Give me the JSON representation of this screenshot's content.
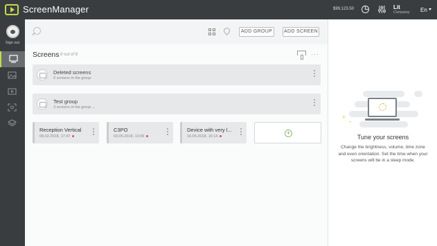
{
  "header": {
    "app_title": "ScreenManager",
    "balance": "$99,123.50",
    "user_name": "Lit",
    "user_role": "Company",
    "language": "En"
  },
  "sidebar": {
    "signout_label": "Sign out",
    "items": [
      "screens-icon",
      "images-icon",
      "video-icon",
      "scan-icon",
      "layers-icon"
    ]
  },
  "toolbar": {
    "add_group_label": "ADD GROUP",
    "add_screen_label": "ADD SCREEN"
  },
  "screens": {
    "title": "Screens",
    "count": "6 out of 6",
    "groups": [
      {
        "name": "Deleted screens",
        "sub": "0 screens in the group"
      },
      {
        "name": "Test group",
        "sub": "3 screens in the group"
      }
    ],
    "cards": [
      {
        "name": "Reception Vertical",
        "date": "08.02.2018, 17:47"
      },
      {
        "name": "C3PO",
        "date": "03.05.2018, 13:09"
      },
      {
        "name": "Device with very l...",
        "date": "16.05.2018, 16:14"
      }
    ],
    "status_color": "#e05050"
  },
  "right_panel": {
    "title": "Tune your screens",
    "description": "Change the brightness, volume, time zone and even orientation. Set the time when your screens will be in a sleep mode."
  },
  "colors": {
    "accent": "#c7d94a",
    "dark": "#3a3d40"
  }
}
